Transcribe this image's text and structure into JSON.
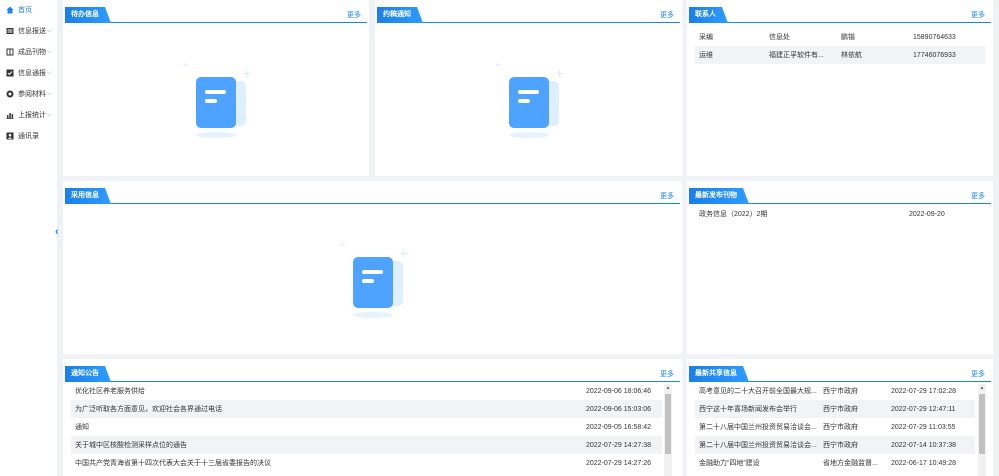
{
  "sidebar": {
    "items": [
      {
        "label": "首页",
        "icon": "home-icon",
        "active": true
      },
      {
        "label": "信息报送",
        "icon": "report-icon",
        "chevron": "⌵"
      },
      {
        "label": "成品刊物",
        "icon": "publication-icon",
        "chevron": "⌵"
      },
      {
        "label": "信息通报",
        "icon": "notice-icon",
        "chevron": "⌵"
      },
      {
        "label": "参阅材料",
        "icon": "reference-icon",
        "chevron": "⌵"
      },
      {
        "label": "上报统计",
        "icon": "chart-icon",
        "chevron": "⌵"
      },
      {
        "label": "通讯录",
        "icon": "contacts-icon"
      }
    ],
    "collapse_arrow": "‹"
  },
  "more_label": "更多",
  "panels": {
    "todo": {
      "title": "待办信息"
    },
    "submit": {
      "title": "约稿通知"
    },
    "contacts": {
      "title": "联系人",
      "rows": [
        {
          "role": "采编",
          "dept": "信息处",
          "name": "鹏锴",
          "phone": "15890764633"
        },
        {
          "role": "运维",
          "dept": "福建正孚软件有...",
          "name": "林依航",
          "phone": "17746076933"
        }
      ]
    },
    "adopted": {
      "title": "采用信息"
    },
    "latest_pub": {
      "title": "最新发布刊物",
      "rows": [
        {
          "title": "政务信息（2022）2期",
          "date": "2022-09-20"
        }
      ]
    },
    "notice": {
      "title": "通知公告",
      "rows": [
        {
          "title": "优化社区养老服务供给",
          "time": "2022-09-06 18:06:46"
        },
        {
          "title": "为广泛听取各方面意见，欢迎社会各界通过电话",
          "time": "2022-09-06 15:03:06"
        },
        {
          "title": "通知",
          "time": "2022-09-05 16:58:42"
        },
        {
          "title": "关于城中区核酸检测采样点位的通告",
          "time": "2022-07-29 14:27:38"
        },
        {
          "title": "中国共产党青海省第十四次代表大会关于十三届省委报告的决议",
          "time": "2022-07-29 14:27:26"
        }
      ]
    },
    "shared": {
      "title": "最新共享信息",
      "rows": [
        {
          "title": "高考意见的二十大召开前全国最大规...",
          "source": "西宁市政府",
          "time": "2022-07-29 17:02:28"
        },
        {
          "title": "西宁这十年喜场新闻发布会举行",
          "source": "西宁市政府",
          "time": "2022-07-29 12:47:11"
        },
        {
          "title": "第二十八届中国兰州投资贸易洽谈会...",
          "source": "西宁市政府",
          "time": "2022-07-29 11:03:55"
        },
        {
          "title": "第二十八届中国兰州投资贸易洽谈会...",
          "source": "西宁市政府",
          "time": "2022-07-14 10:37:38"
        },
        {
          "title": "金融助力“四地”建设",
          "source": "省地方金融监督...",
          "time": "2022-06-17 10:49:28"
        }
      ]
    }
  },
  "colors": {
    "accent": "#1684fc",
    "background": "#f0f2f5",
    "empty_doc": "#4da3ff"
  }
}
